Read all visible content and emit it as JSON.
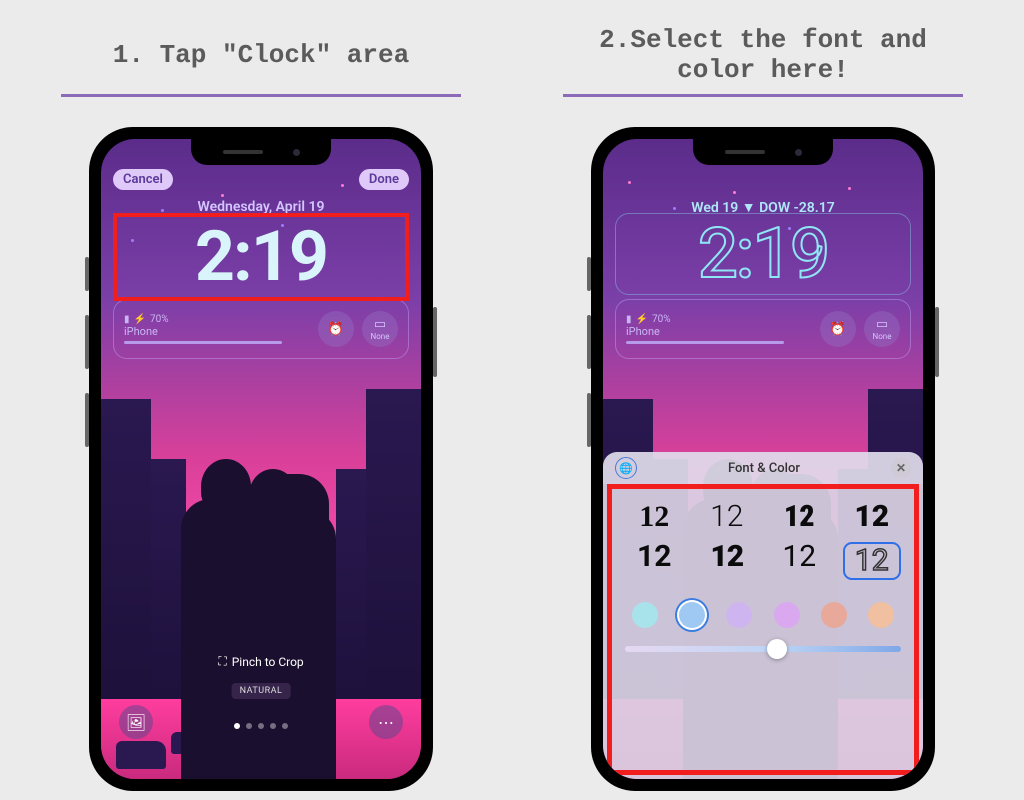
{
  "steps": {
    "one": "1. Tap \"Clock\" area",
    "two": "2.Select the font and\ncolor here!"
  },
  "phone1": {
    "cancel": "Cancel",
    "done": "Done",
    "date": "Wednesday, April 19",
    "time": "2:19",
    "battery_pct": "70%",
    "device": "iPhone",
    "widget_none": "None",
    "pinch": "Pinch to Crop",
    "tag": "NATURAL"
  },
  "phone2": {
    "date": "Wed 19  ▼ DOW -28.17",
    "time": "2:19",
    "battery_pct": "70%",
    "device": "iPhone",
    "widget_none": "None",
    "panel_title": "Font & Color",
    "font_sample": "12",
    "colors": [
      {
        "hex": "#a8e3ec",
        "selected": false
      },
      {
        "hex": "#9fc9f2",
        "selected": true
      },
      {
        "hex": "#cfb5ef",
        "selected": false
      },
      {
        "hex": "#d9a8ef",
        "selected": false
      },
      {
        "hex": "#e8a89a",
        "selected": false
      },
      {
        "hex": "#f0c0a0",
        "selected": false
      }
    ]
  }
}
